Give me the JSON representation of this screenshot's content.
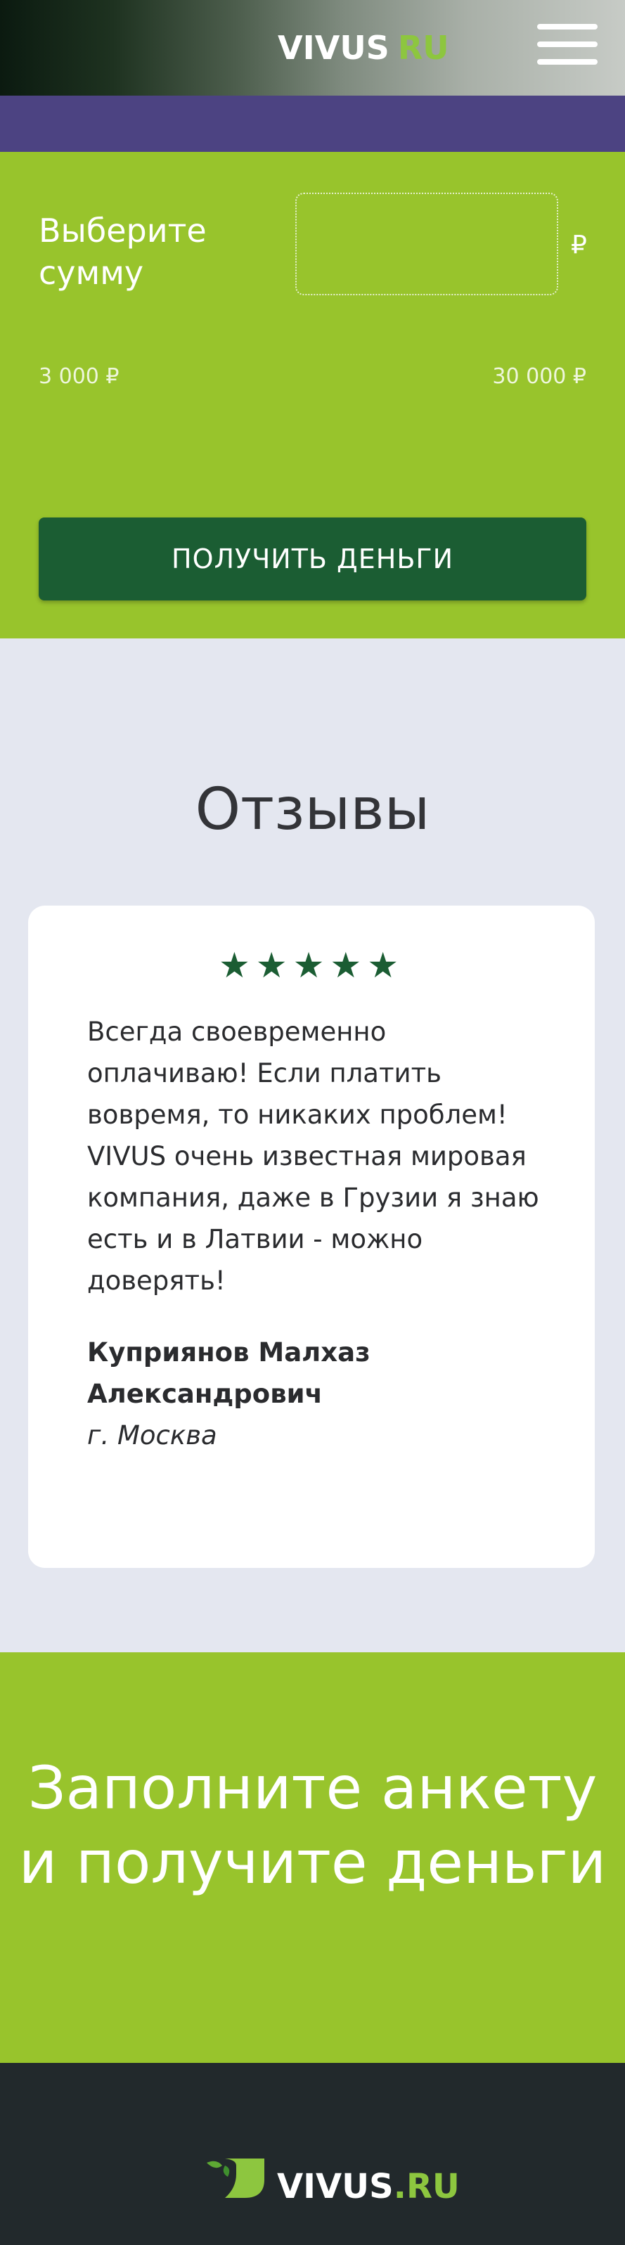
{
  "header": {
    "logo_main": "VIVUS",
    "logo_accent": "RU",
    "menu_icon": "hamburger-menu-icon"
  },
  "calculator": {
    "label": "Выберите сумму",
    "amount_value": "",
    "currency_symbol": "₽",
    "min_label": "3 000 ₽",
    "max_label": "30 000 ₽",
    "button_label": "ПОЛУЧИТЬ ДЕНЬГИ"
  },
  "reviews": {
    "title": "Отзывы",
    "rating": 5,
    "stars": "★★★★★",
    "items": [
      {
        "text": "Всегда своевременно оплачиваю! Если платить вовремя, то никаких проблем! VIVUS очень известная мировая компания, даже в Грузии я знаю есть и в Латвии - можно доверять!",
        "author": "Куприянов Малхаз Александрович",
        "city": "г. Москва"
      }
    ]
  },
  "cta": {
    "text": "Заполните анкету и получите деньги"
  },
  "footer": {
    "logo_main": "VIVUS",
    "logo_dot": ".",
    "logo_accent": "RU",
    "logo_icon": "vivus-leaf-logo-icon"
  },
  "colors": {
    "brand_green": "#98c42c",
    "dark_green": "#1b5d33",
    "purple": "#4c4382",
    "footer_bg": "#22292c",
    "page_bg": "#e4e7f0"
  }
}
